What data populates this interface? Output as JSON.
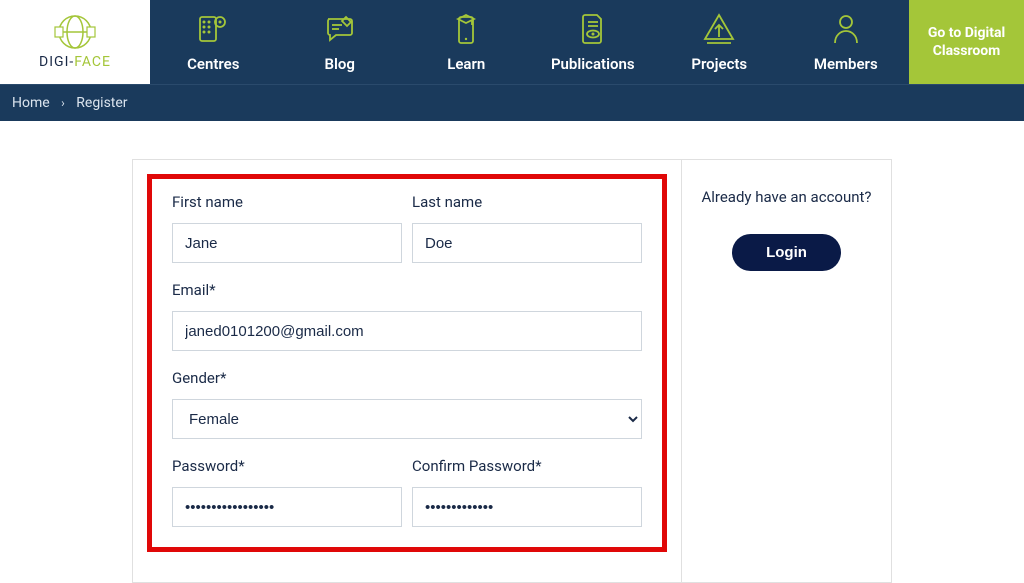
{
  "logo": {
    "text_left": "DIGI-",
    "text_right": "FACE"
  },
  "nav": [
    {
      "label": "Centres"
    },
    {
      "label": "Blog"
    },
    {
      "label": "Learn"
    },
    {
      "label": "Publications"
    },
    {
      "label": "Projects"
    },
    {
      "label": "Members"
    }
  ],
  "cta": {
    "label": "Go to Digital Classroom"
  },
  "breadcrumb": {
    "home": "Home",
    "sep": "›",
    "current": "Register"
  },
  "form": {
    "first_name": {
      "label": "First name",
      "value": "Jane"
    },
    "last_name": {
      "label": "Last name",
      "value": "Doe"
    },
    "email": {
      "label": "Email*",
      "value": "janed0101200@gmail.com"
    },
    "gender": {
      "label": "Gender*",
      "value": "Female"
    },
    "password": {
      "label": "Password*",
      "value": "•••••••••••••••••"
    },
    "confirm_password": {
      "label": "Confirm Password*",
      "value": "•••••••••••••"
    }
  },
  "side": {
    "title": "Already have an account?",
    "login_label": "Login"
  }
}
